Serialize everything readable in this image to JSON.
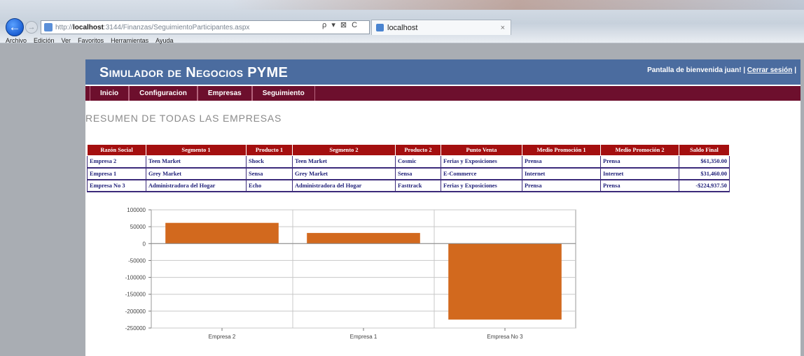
{
  "browser": {
    "address_prefix": "http://",
    "address_host": "localhost",
    "address_path": ":3144/Finanzas/SeguimientoParticipantes.aspx",
    "address_controls": "ρ ▾ ⊠ C",
    "tab_title": "localhost",
    "tab_close": "×",
    "back_icon": "←",
    "forward_icon": "→",
    "menu": [
      "Archivo",
      "Edición",
      "Ver",
      "Favoritos",
      "Herramientas",
      "Ayuda"
    ]
  },
  "site": {
    "title": "Simulador de Negocios PYME",
    "welcome": "Pantalla de bienvenida juan!",
    "separator_left": "|",
    "logout": "Cerrar sesión",
    "separator_right": "|"
  },
  "nav": [
    "Inicio",
    "Configuracion",
    "Empresas",
    "Seguimiento"
  ],
  "page_heading": "RESUMEN DE TODAS LAS EMPRESAS",
  "table": {
    "headers": [
      "Razón Social",
      "Segmento 1",
      "Producto 1",
      "Segmento 2",
      "Producto 2",
      "Punto Venta",
      "Medio Promoción 1",
      "Medio Promoción 2",
      "Saldo Final"
    ],
    "rows": [
      [
        "Empresa 2",
        "Teen Market",
        "Shock",
        "Teen Market",
        "Cosmic",
        "Ferias y Exposiciones",
        "Prensa",
        "Prensa",
        "$61,350.00"
      ],
      [
        "Empresa 1",
        "Grey Market",
        "Sensa",
        "Grey Market",
        "Sensa",
        "E-Commerce",
        "Internet",
        "Internet",
        "$31,460.00"
      ],
      [
        "Empresa No 3",
        "Administradora del Hogar",
        "Echo",
        "Administradora del Hogar",
        "Fasttrack",
        "Ferias y Exposiciones",
        "Prensa",
        "Prensa",
        "-$224,937.50"
      ]
    ]
  },
  "chart_data": {
    "type": "bar",
    "categories": [
      "Empresa 2",
      "Empresa 1",
      "Empresa No 3"
    ],
    "values": [
      61350,
      31460,
      -224937.5
    ],
    "ylim": [
      -250000,
      100000
    ],
    "yticks": [
      100000,
      50000,
      0,
      -50000,
      -100000,
      -150000,
      -200000,
      -250000
    ],
    "ytick_labels": [
      "100000",
      "50000",
      "0",
      "-50000",
      "-100000",
      "-150000",
      "-200000",
      "-250000"
    ],
    "grid": true,
    "bar_color": "#d2691e"
  }
}
